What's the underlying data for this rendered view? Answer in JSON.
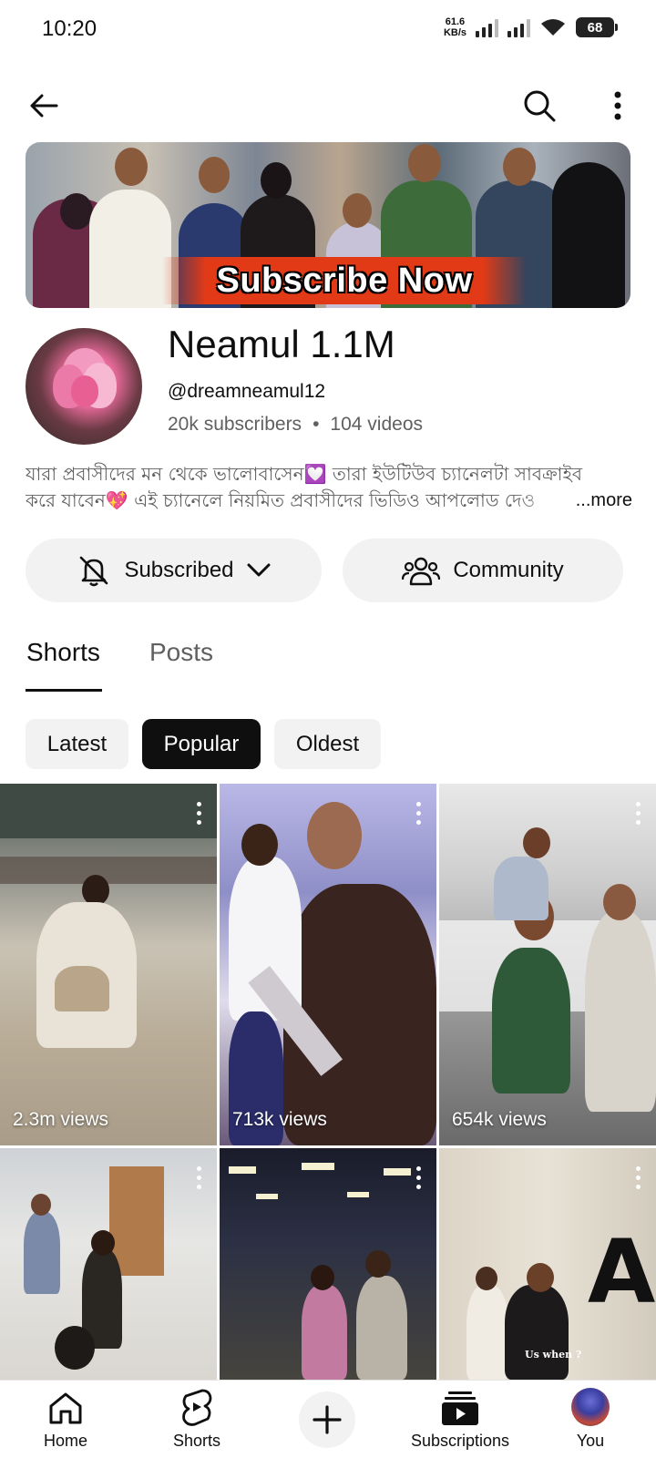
{
  "status_bar": {
    "time": "10:20",
    "net_speed_value": "61.6",
    "net_speed_unit": "KB/s",
    "battery": "68"
  },
  "banner": {
    "text": "Subscribe Now"
  },
  "channel": {
    "name": "Neamul 1.1M",
    "handle": "@dreamneamul12",
    "subscribers": "20k subscribers",
    "separator": "•",
    "videos": "104 videos",
    "description_line1": "যারা প্রবাসীদের মন থেকে ভালোবাসেন💟 তারা ইউটিউব চ্যানেলটা সাবক্রাইব",
    "description_line2": "করে যাবেন💖 এই চ্যানেলে নিয়মিত প্রবাসীদের ভিডিও আপলোড দেও",
    "more_label": "...more"
  },
  "actions": {
    "subscribed_label": "Subscribed",
    "community_label": "Community"
  },
  "tabs": [
    {
      "label": "Shorts",
      "active": true
    },
    {
      "label": "Posts",
      "active": false
    }
  ],
  "filters": [
    {
      "label": "Latest",
      "active": false
    },
    {
      "label": "Popular",
      "active": true
    },
    {
      "label": "Oldest",
      "active": false
    }
  ],
  "shorts": [
    {
      "views": "2.3m views"
    },
    {
      "views": "713k views"
    },
    {
      "views": "654k views"
    },
    {
      "views": ""
    },
    {
      "views": ""
    },
    {
      "views": "",
      "overlay_text": "Us when ?",
      "sign_letter": "A"
    }
  ],
  "bottom_nav": {
    "home_label": "Home",
    "shorts_label": "Shorts",
    "subscriptions_label": "Subscriptions",
    "you_label": "You"
  },
  "colors": {
    "text_primary": "#0f0f0f",
    "text_secondary": "#606060",
    "chip_bg": "#f2f2f2",
    "banner_accent": "#e23a16"
  }
}
